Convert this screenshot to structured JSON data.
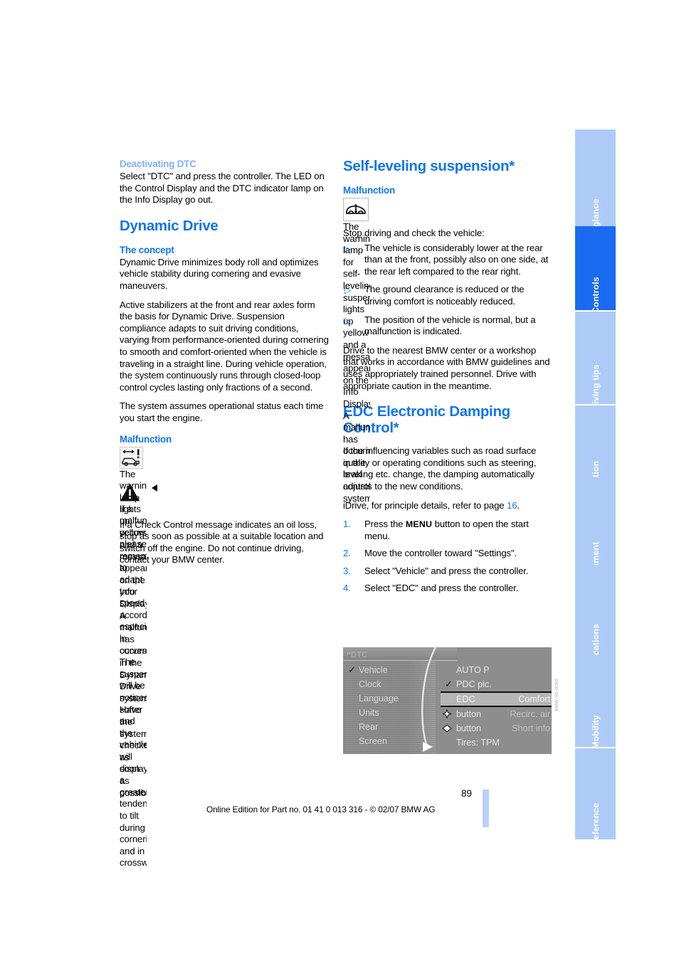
{
  "document": {
    "page_number": "89",
    "footer": "Online Edition for Part no. 01 41 0 013 316 - © 02/07 BMW AG",
    "figure_code": "BMW-00-0089"
  },
  "colors": {
    "heading_blue": "#1274f0",
    "pale_blue": "#7fb1f5",
    "tab_inactive": "#aecbf7",
    "tab_active": "#1a6bf0",
    "page_bar": "#b9d2f8"
  },
  "left_column": {
    "deactivating_dtc": {
      "heading": "Deactivating DTC",
      "paragraphs": [
        "Select \"DTC\" and press the controller. The LED on the Control Display and the DTC indicator lamp on the Info Display go out."
      ]
    },
    "dynamic_drive": {
      "heading": "Dynamic Drive",
      "concept": {
        "heading": "The concept",
        "paragraphs": [
          "Dynamic Drive minimizes body roll and optimizes vehicle stability during cornering and evasive maneuvers.",
          "Active stabilizers at the front and rear axles form the basis for Dynamic Drive. Suspension compliance adapts to suit driving conditions, varying from performance-oriented during cornering to smooth and comfort-oriented when the vehicle is traveling in a straight line. During vehicle operation, the system continuously runs through closed-loop control cycles lasting only fractions of a second.",
          "The system assumes operational status each time you start the engine."
        ]
      },
      "malfunction": {
        "heading": "Malfunction",
        "lamp_icon": "dynamic-drive-warning-lamp-icon",
        "lamp_text": "The warning lamp lights up yellow and a message appears on the Info Display. A malfunction has occurred in the Dynamic Drive system. Have the system checked as soon as possible.",
        "caution_icon": "warning-triangle-icon",
        "caution_text": "If a malfunction occurs, please remember to adapt your speed accordingly, especially in curves. The suspension will be noticeably softer and the vehicle will display a greater tendency to tilt during cornering and in crosswinds.",
        "after_caution": "If a Check Control message indicates an oil loss, stop as soon as possible at a suitable location and switch off the engine. Do not continue driving, contact your BMW center."
      }
    }
  },
  "right_column": {
    "self_leveling": {
      "heading": "Self-leveling suspension*",
      "malfunction_heading": "Malfunction",
      "lamp_icon": "self-leveling-suspension-lamp-icon",
      "lamp_text": "The warning lamp for self-leveling suspension lights up yellow and a message appears on the Info Display. A malfunction has occurred in the level control system.",
      "stop_line": "Stop driving and check the vehicle:",
      "bullets": [
        "The vehicle is considerably lower at the rear than at the front, possibly also on one side, at the rear left compared to the rear right.",
        "The ground clearance is reduced or the driving comfort is noticeably reduced.",
        "The position of the vehicle is normal, but a malfunction is indicated."
      ],
      "closing": "Drive to the nearest BMW center or a workshop that works in accordance with BMW guidelines and uses appropriately trained personnel. Drive with appropriate caution in the meantime."
    },
    "edc": {
      "heading": "EDC Electronic Damping Control*",
      "intro": "If the influencing variables such as road surface quality or operating conditions such as steering, braking etc. change, the damping automatically adjusts to the new conditions.",
      "idrive_ref_prefix": "iDrive, for principle details, refer to page ",
      "idrive_ref_page": "16",
      "idrive_ref_suffix": ".",
      "steps": [
        {
          "num": "1.",
          "pre": "Press the ",
          "kbd": "MENU",
          "post": " button to open the start menu."
        },
        {
          "num": "2.",
          "pre": "Move the controller toward \"Settings\".",
          "kbd": "",
          "post": ""
        },
        {
          "num": "3.",
          "pre": "Select \"Vehicle\" and press the controller.",
          "kbd": "",
          "post": ""
        },
        {
          "num": "4.",
          "pre": "Select \"EDC\" and press the controller.",
          "kbd": "",
          "post": ""
        }
      ]
    }
  },
  "idrive_figure": {
    "title": "DTC",
    "left_menu": [
      {
        "label": "Vehicle",
        "checked": true
      },
      {
        "label": "Clock",
        "checked": false
      },
      {
        "label": "Language",
        "checked": false
      },
      {
        "label": "Units",
        "checked": false
      },
      {
        "label": "Rear",
        "checked": false
      },
      {
        "label": "Screen",
        "checked": false
      }
    ],
    "right_menu": [
      {
        "label": "AUTO P",
        "value": "",
        "checked": false,
        "glyph": "",
        "selected": false
      },
      {
        "label": "PDC pic.",
        "value": "",
        "checked": true,
        "glyph": "",
        "selected": false
      },
      {
        "label": "EDC",
        "value": "Comfort",
        "checked": false,
        "glyph": "",
        "selected": true
      },
      {
        "label": "button",
        "value": "Recirc. air",
        "checked": false,
        "glyph": "star-diamond-icon",
        "selected": false
      },
      {
        "label": "button",
        "value": "Short info",
        "checked": false,
        "glyph": "diamond-icon",
        "selected": false
      },
      {
        "label": "Tires: TPM",
        "value": "",
        "checked": false,
        "glyph": "",
        "selected": false
      }
    ]
  },
  "tabs": [
    {
      "label": "At a glance",
      "active": false
    },
    {
      "label": "Controls",
      "active": true
    },
    {
      "label": "Driving tips",
      "active": false
    },
    {
      "label": "Navigation",
      "active": false
    },
    {
      "label": "Entertainment",
      "active": false
    },
    {
      "label": "Communications",
      "active": false
    },
    {
      "label": "Mobility",
      "active": false
    },
    {
      "label": "Reference",
      "active": false
    }
  ]
}
